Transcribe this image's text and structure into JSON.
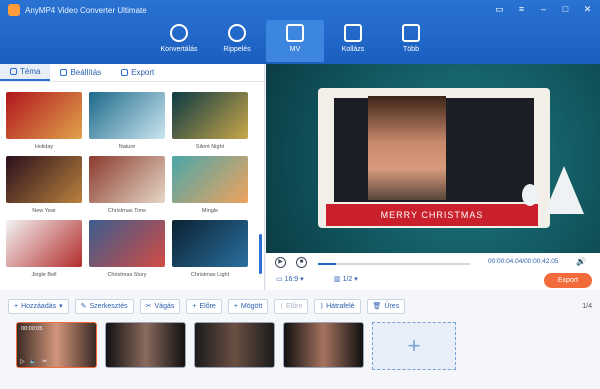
{
  "app": {
    "title": "AnyMP4 Video Converter Ultimate"
  },
  "colors": {
    "brand": "#1f67c8",
    "accent": "#f26b3a",
    "banner": "#c9202c"
  },
  "main_tabs": [
    {
      "label": "Konvertálás",
      "icon": "convert-icon"
    },
    {
      "label": "Rippelés",
      "icon": "disc-icon"
    },
    {
      "label": "MV",
      "icon": "mv-icon"
    },
    {
      "label": "Kollázs",
      "icon": "collage-icon"
    },
    {
      "label": "Több",
      "icon": "toolbox-icon"
    }
  ],
  "sub_tabs": [
    {
      "label": "Téma"
    },
    {
      "label": "Beállítás"
    },
    {
      "label": "Export"
    }
  ],
  "themes": [
    {
      "label": "Holiday",
      "c": [
        "#b1161c",
        "#e0a34b"
      ]
    },
    {
      "label": "Nature",
      "c": [
        "#1e6a8a",
        "#cbe5f0"
      ]
    },
    {
      "label": "Silent Night",
      "c": [
        "#0d3a42",
        "#c8a64a"
      ]
    },
    {
      "label": "New Year",
      "c": [
        "#2b0f1c",
        "#b9823e"
      ]
    },
    {
      "label": "Christmas Time",
      "c": [
        "#8a3a2d",
        "#e6d7c7"
      ]
    },
    {
      "label": "Mingle",
      "c": [
        "#4aa7a8",
        "#f0a25e"
      ]
    },
    {
      "label": "Jingle Bell",
      "c": [
        "#f3f3f3",
        "#b32c2c"
      ]
    },
    {
      "label": "Christmas Story",
      "c": [
        "#3b5d8f",
        "#d24b43"
      ]
    },
    {
      "label": "Christmas Light",
      "c": [
        "#0b2233",
        "#2a6f9e"
      ]
    }
  ],
  "preview": {
    "banner_text": "MERRY CHRISTMAS"
  },
  "playback": {
    "time": "00:00:04.04/00:00:42.05",
    "ratio": "16:9",
    "split": "1/2",
    "export_label": "Export",
    "progress": 0.12
  },
  "toolbar": [
    {
      "label": "Hozzáadás",
      "icon": "plus-icon"
    },
    {
      "label": "Szerkesztés",
      "icon": "magic-wand-icon"
    },
    {
      "label": "Vágás",
      "icon": "scissors-icon"
    },
    {
      "label": "Előre",
      "icon": "forward-icon"
    },
    {
      "label": "Mögött",
      "icon": "behind-icon"
    },
    {
      "label": "Előre",
      "icon": "forward-icon",
      "disabled": true
    },
    {
      "label": "Hátrafelé",
      "icon": "backward-icon"
    },
    {
      "label": "Üres",
      "icon": "trash-icon"
    }
  ],
  "page_index": "1/4",
  "clips": [
    {
      "time": "00:00:05",
      "c": [
        "#3a2a25",
        "#d2967a"
      ]
    },
    {
      "time": "",
      "c": [
        "#111",
        "#8a6a5e"
      ]
    },
    {
      "time": "",
      "c": [
        "#1b1b1b",
        "#6a4f42"
      ]
    },
    {
      "time": "",
      "c": [
        "#101010",
        "#a6735f"
      ]
    }
  ]
}
